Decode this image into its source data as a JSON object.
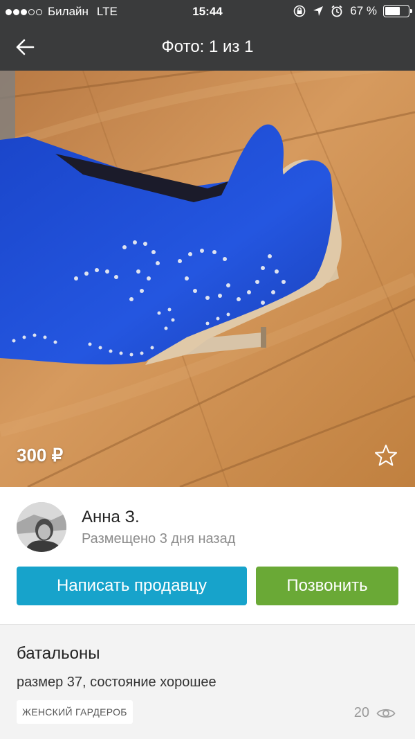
{
  "status_bar": {
    "carrier": "Билайн",
    "network": "LTE",
    "time": "15:44",
    "battery_level": "67 %",
    "battery_fraction": 0.67,
    "icons": [
      "signal-dots-icon",
      "rotation-lock-icon",
      "location-arrow-icon",
      "alarm-icon",
      "battery-icon"
    ]
  },
  "nav": {
    "title": "Фото: 1 из 1",
    "back_icon": "arrow-left-icon"
  },
  "photo": {
    "price": "300 ₽",
    "favorite_icon": "star-outline-icon"
  },
  "seller": {
    "name": "Анна З.",
    "posted": "Размещено 3 дня назад",
    "message_button": "Написать продавцу",
    "call_button": "Позвонить"
  },
  "item": {
    "title": "батальоны",
    "description": "размер 37, состояние хорошее",
    "category": "ЖЕНСКИЙ ГАРДЕРОБ",
    "views": "20",
    "views_icon": "eye-icon"
  },
  "colors": {
    "bar_background": "#3a3b3c",
    "message_button": "#17a3cb",
    "call_button": "#6aa936",
    "boot_blue": "#1e4fd6",
    "floor_wood": "#c98a4f"
  }
}
